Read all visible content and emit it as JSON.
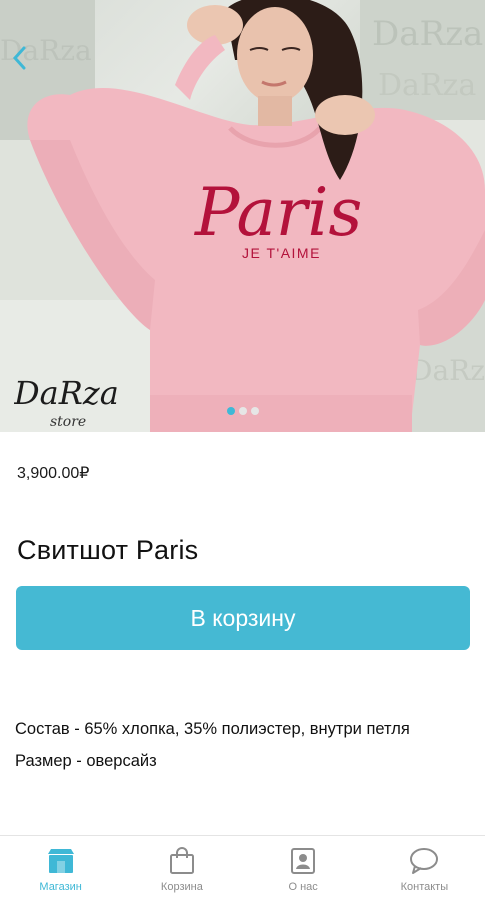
{
  "hero": {
    "logo_text": "DaRza",
    "logo_sub": "store",
    "print_main": "Paris",
    "print_sub": "JE T'AIME",
    "carousel": {
      "count": 3,
      "active_index": 0
    }
  },
  "product": {
    "price": "3,900.00₽",
    "title": "Свитшот Paris",
    "cart_button_label": "В корзину",
    "description": [
      "Состав - 65% хлопка, 35% полиэстер, внутри петля",
      "Размер - оверсайз"
    ]
  },
  "bottom_nav": {
    "items": [
      {
        "label": "Магазин",
        "icon": "store-icon",
        "active": true
      },
      {
        "label": "Корзина",
        "icon": "shopping-bag-icon",
        "active": false
      },
      {
        "label": "О нас",
        "icon": "contact-card-icon",
        "active": false
      },
      {
        "label": "Контакты",
        "icon": "chat-bubble-icon",
        "active": false
      }
    ]
  },
  "colors": {
    "accent": "#45b9d3",
    "nav_active": "#3fb8d6",
    "nav_inactive": "#8c8c8c",
    "sweater": "#f2b8c1",
    "print": "#b3123b"
  }
}
